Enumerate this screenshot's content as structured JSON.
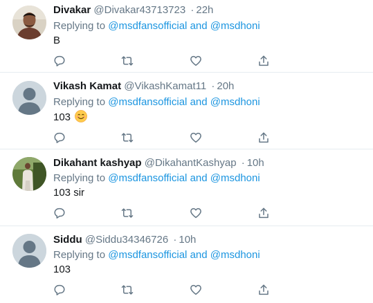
{
  "tweets": [
    {
      "name": "Divakar",
      "handle": "@Divakar43713723",
      "separator": "·",
      "time": "22h",
      "replying_prefix": "Replying to",
      "mention1": "@msdfansofficial",
      "conjunction": "and",
      "mention2": "@msdhoni",
      "text": "B",
      "avatar": "photo"
    },
    {
      "name": "Vikash Kamat",
      "handle": "@VikashKamat11",
      "separator": "·",
      "time": "20h",
      "replying_prefix": "Replying to",
      "mention1": "@msdfansofficial",
      "conjunction": "and",
      "mention2": "@msdhoni",
      "text": "103",
      "emoji": "smiling-face-emoji",
      "avatar": "default-profile"
    },
    {
      "name": "Dikahant kashyap",
      "handle": "@DikahantKashyap",
      "separator": "·",
      "time": "10h",
      "replying_prefix": "Replying to",
      "mention1": "@msdfansofficial",
      "conjunction": "and",
      "mention2": "@msdhoni",
      "text": "103 sir",
      "avatar": "photo"
    },
    {
      "name": "Siddu",
      "handle": "@Siddu34346726",
      "separator": "·",
      "time": "10h",
      "replying_prefix": "Replying to",
      "mention1": "@msdfansofficial",
      "conjunction": "and",
      "mention2": "@msdhoni",
      "text": "103",
      "avatar": "default-profile"
    }
  ],
  "actions": [
    "reply-icon",
    "retweet-icon",
    "like-icon",
    "share-icon"
  ],
  "colors": {
    "name": "#14171a",
    "secondary": "#657786",
    "link": "#1b95e0",
    "divider": "#e6ecf0",
    "icon": "#657786",
    "default_avatar_bg": "#ccd6dd",
    "default_avatar_fg": "#657786"
  }
}
